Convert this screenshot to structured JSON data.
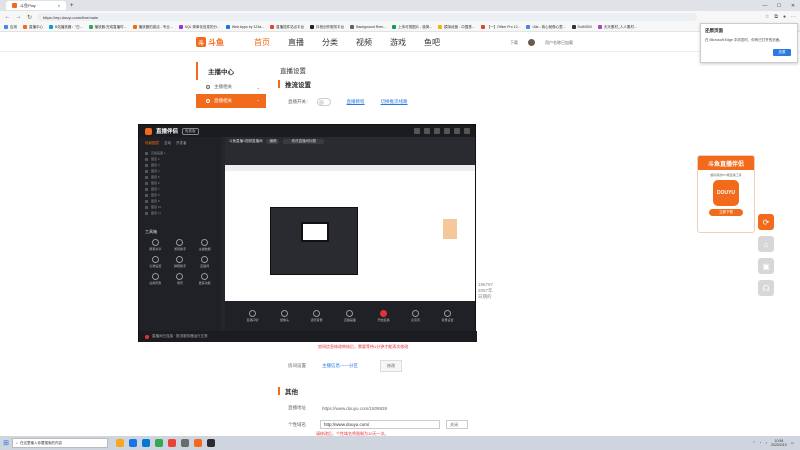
{
  "browser": {
    "tab_title": "斗鱼Play",
    "url": "https://mp.douyu.com/live/main",
    "bookmarks": [
      {
        "label": "应用",
        "color": "#4285f4"
      },
      {
        "label": "直播中心",
        "color": "#f26a1b"
      },
      {
        "label": "B站播放器：\"白...",
        "color": "#00a1d6"
      },
      {
        "label": "播放器-完成直播时...",
        "color": "#34a853"
      },
      {
        "label": "播放器的激活 - 专业...",
        "color": "#e8710a"
      },
      {
        "label": "SQL 简单化信息的分...",
        "color": "#9334e6"
      },
      {
        "label": "Web Apps by 123a...",
        "color": "#1a73e8"
      },
      {
        "label": "直播插件站点平台",
        "color": "#ea4335"
      },
      {
        "label": "抖音创作服务平台",
        "color": "#222222"
      },
      {
        "label": "Background Rem...",
        "color": "#5f6368"
      },
      {
        "label": "上传可视图片 - 极简...",
        "color": "#0f9d58"
      },
      {
        "label": "模拟经营 - 中国首...",
        "color": "#f4b400"
      },
      {
        "label": "【一】Office Pro 12...",
        "color": "#db4437"
      },
      {
        "label": "Ulla - 我心就像心里...",
        "color": "#4285f4"
      },
      {
        "label": "SoftV500",
        "color": "#333333"
      },
      {
        "label": "天天素材_人人素材...",
        "color": "#ab47bc"
      }
    ]
  },
  "site": {
    "logo_badge": "斗",
    "logo_text": "斗鱼",
    "nav": [
      "首页",
      "直播",
      "分类",
      "视频",
      "游戏",
      "鱼吧"
    ],
    "download": "下载",
    "username": "用户名称已加载"
  },
  "sidebar": {
    "title": "主播中心",
    "items": [
      {
        "label": "主播相关",
        "active": false
      },
      {
        "label": "直播相关",
        "active": true
      }
    ]
  },
  "content": {
    "page_title": "直播设置",
    "section_push": "推流设置",
    "push_switch_label": "直播开关：",
    "push_link1": "直播教程",
    "push_link2": "切换推流线路",
    "side_numbers": [
      "196797",
      "2057年",
      "日期的"
    ],
    "warning_text": "房间信息修改审核后，需要等待1分钟才能再次修改",
    "room_label": "房间设置",
    "room_link": "主播信息——分区",
    "modify_button": "修改",
    "section_other": "其他",
    "room_url_label": "直播地址",
    "room_url_value": "https://www.douyu.com/1509939",
    "custom_label": "个性域名",
    "custom_value": "http://www.douyu.com/",
    "custom_select": "关闭",
    "custom_hint": "请修改后，个性域名将限制为10天一次。"
  },
  "app": {
    "title": "直播伴侣",
    "badge": "免费版",
    "tabs": [
      "场景图层",
      "互动",
      "开发者"
    ],
    "scenes": [
      "直播画面 1",
      "图层 2",
      "图层 3",
      "图层 4",
      "图层 5",
      "图层 6",
      "图层 7",
      "图层 8",
      "图层 9",
      "图层 10",
      "图层 11"
    ],
    "tools_label": "工具箱",
    "tools": [
      "屏幕共享",
      "游戏助手",
      "主播数据",
      "礼物设置",
      "弹幕助手",
      "直播间",
      "虚拟形象",
      "场景",
      "更多功能"
    ],
    "preview_tab": "斗鱼直播1视频直播间",
    "preview_chip": "编辑",
    "preview_chip2": "修改直播间标题",
    "controls": [
      "直播间管",
      "摄像头",
      "话筒音量",
      "直播画面",
      "开始直播",
      "麦克风",
      "音量设置"
    ],
    "status_text": "直播间已连接 · 推流服务器运行正常"
  },
  "promo": {
    "title": "斗鱼直播伴侣",
    "subtitle": "超好用的PC端直播工具",
    "icon_text": "DOUYU",
    "button": "立即下载"
  },
  "notification": {
    "title": "还原页面",
    "body": "在 Microsoft Edge 中浏览时，你有已打开的页面。",
    "button": "还原"
  },
  "taskbar": {
    "search_placeholder": "在这里输入你要搜索的内容",
    "app_colors": [
      "#f5a623",
      "#1a73e8",
      "#0078d4",
      "#34a853",
      "#ea4335",
      "#6b6b6b",
      "#f26a1b",
      "#2a2b31"
    ],
    "time": "10:58",
    "date": "2020/2/10"
  }
}
